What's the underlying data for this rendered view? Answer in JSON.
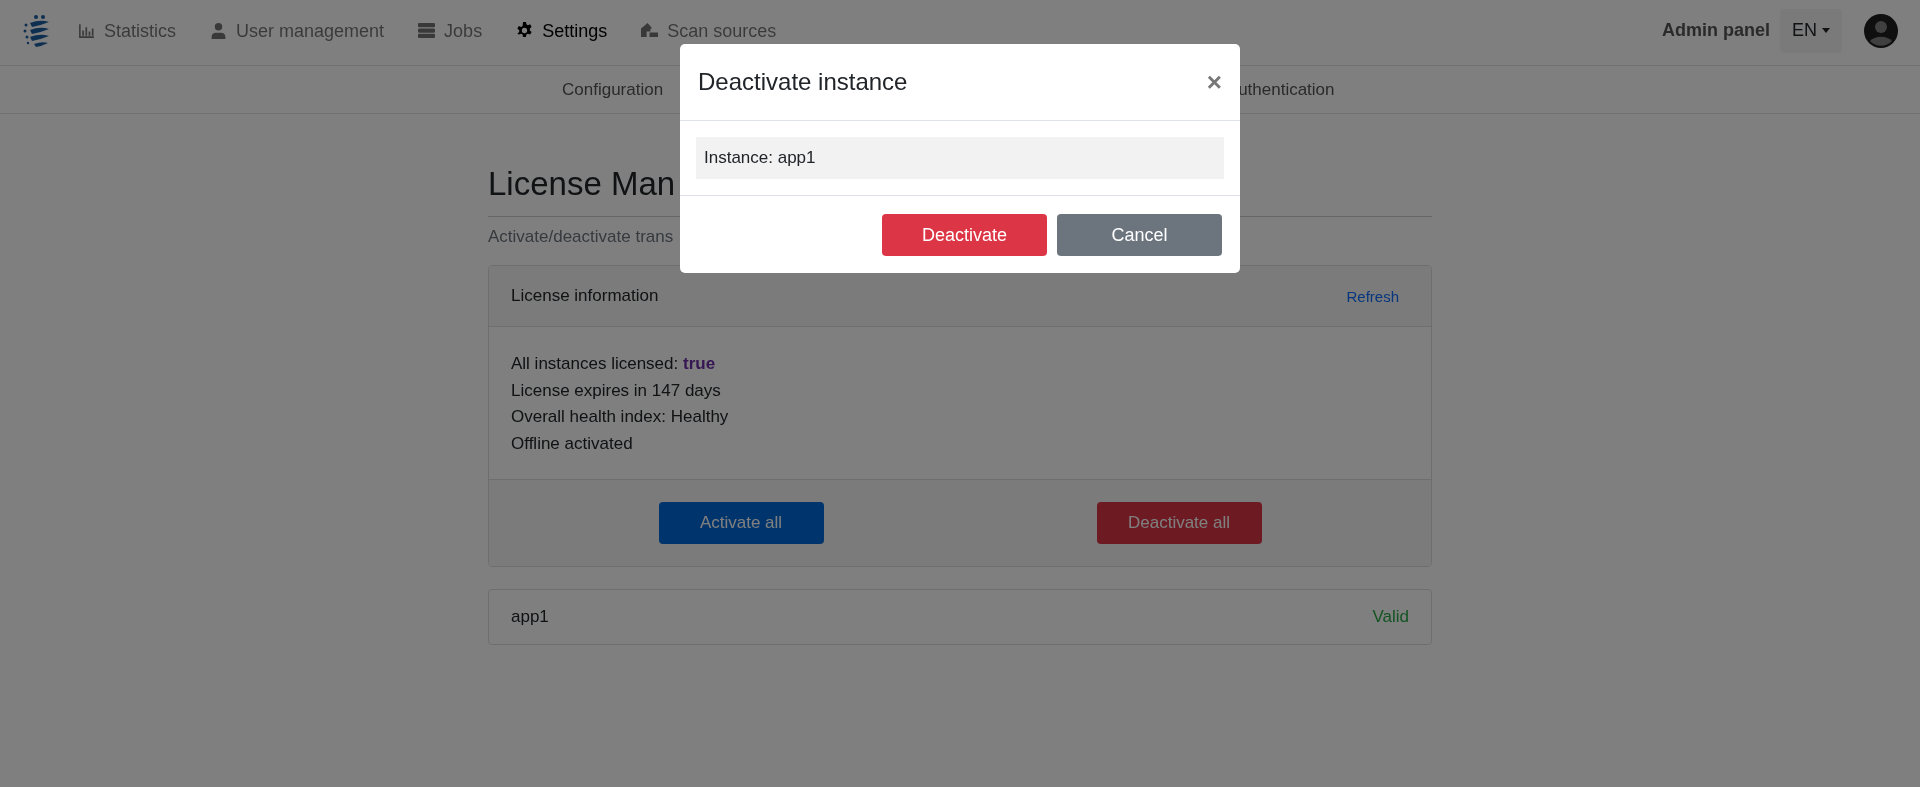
{
  "navbar": {
    "items": [
      {
        "label": "Statistics",
        "selected": false
      },
      {
        "label": "User management",
        "selected": false
      },
      {
        "label": "Jobs",
        "selected": false
      },
      {
        "label": "Settings",
        "selected": true
      },
      {
        "label": "Scan sources",
        "selected": false
      }
    ],
    "admin_panel": "Admin panel",
    "language": "EN"
  },
  "subnav": {
    "items": [
      {
        "label": "Configuration"
      },
      {
        "label": "uthentication"
      }
    ]
  },
  "page": {
    "title": "License Man",
    "subtitle": "Activate/deactivate trans",
    "license_card": {
      "title": "License information",
      "refresh": "Refresh",
      "lines": [
        "All instances licensed: **true**",
        "License expires in 147 days",
        "Overall health index: Healthy",
        "Offline activated"
      ],
      "activate_all": "Activate all",
      "deactivate_all": "Deactivate all"
    },
    "instances": [
      {
        "name": "app1",
        "status": "Valid"
      }
    ]
  },
  "modal": {
    "title": "Deactivate instance",
    "close": "×",
    "instance": "Instance: app1",
    "confirm": "Deactivate",
    "cancel": "Cancel"
  }
}
